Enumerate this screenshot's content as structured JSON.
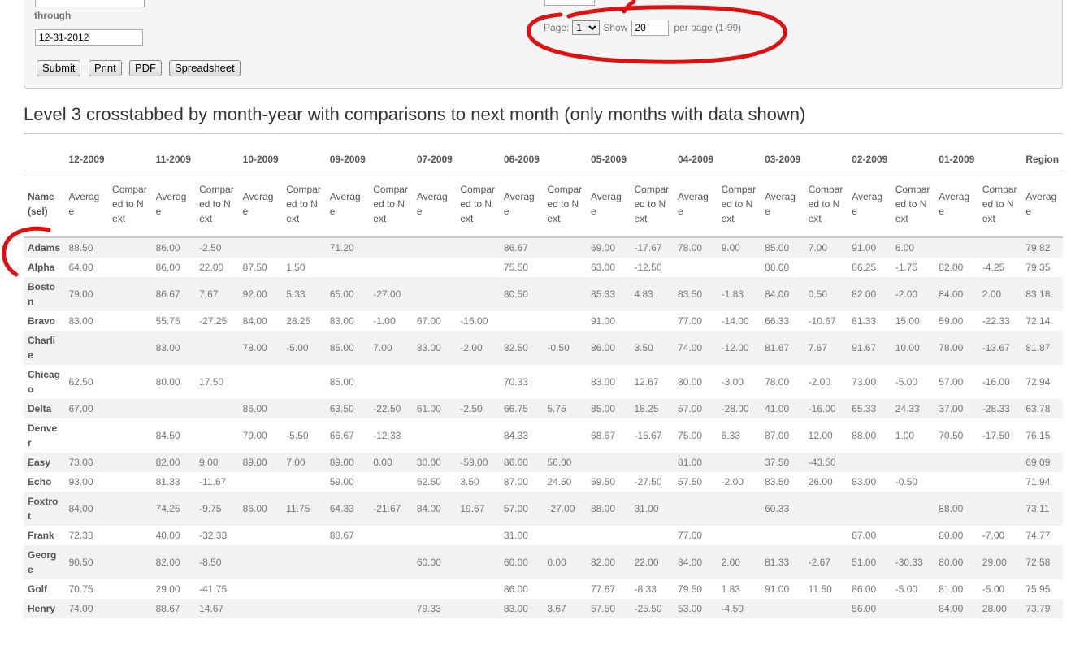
{
  "form": {
    "through_label": "through",
    "end_date": "12-31-2012",
    "buttons": [
      "Submit",
      "Print",
      "PDF",
      "Spreadsheet"
    ],
    "page_label": "Page:",
    "page_value": "1",
    "show_label": "Show",
    "show_value": "20",
    "per_page_label": "per page (1-99)"
  },
  "report_title": "Level 3 crosstabbed by month-year with comparisons to next month (only months with data shown)",
  "table": {
    "months": [
      "12-2009",
      "11-2009",
      "10-2009",
      "09-2009",
      "07-2009",
      "06-2009",
      "05-2009",
      "04-2009",
      "03-2009",
      "02-2009",
      "01-2009"
    ],
    "region_label": "Region",
    "name_header": "Name (sel)",
    "average_header": "Average",
    "compared_header": "Compared to Next",
    "rows": [
      {
        "name": "Adams",
        "cells": [
          "88.50",
          "",
          "86.00",
          "-2.50",
          "",
          "",
          "71.20",
          "",
          "",
          "",
          "86.67",
          "",
          "69.00",
          "-17.67",
          "78.00",
          "9.00",
          "85.00",
          "7.00",
          "91.00",
          "6.00",
          "",
          ""
        ],
        "region": "79.82"
      },
      {
        "name": "Alpha",
        "cells": [
          "64.00",
          "",
          "86.00",
          "22.00",
          "87.50",
          "1.50",
          "",
          "",
          "",
          "",
          "75.50",
          "",
          "63.00",
          "-12.50",
          "",
          "",
          "88.00",
          "",
          "86.25",
          "-1.75",
          "82.00",
          "-4.25"
        ],
        "region": "79.35"
      },
      {
        "name": "Boston",
        "cells": [
          "79.00",
          "",
          "86.67",
          "7.67",
          "92.00",
          "5.33",
          "65.00",
          "-27.00",
          "",
          "",
          "80.50",
          "",
          "85.33",
          "4.83",
          "83.50",
          "-1.83",
          "84.00",
          "0.50",
          "82.00",
          "-2.00",
          "84.00",
          "2.00"
        ],
        "region": "83.18"
      },
      {
        "name": "Bravo",
        "cells": [
          "83.00",
          "",
          "55.75",
          "-27.25",
          "84.00",
          "28.25",
          "83.00",
          "-1.00",
          "67.00",
          "-16.00",
          "",
          "",
          "91.00",
          "",
          "77.00",
          "-14.00",
          "66.33",
          "-10.67",
          "81.33",
          "15.00",
          "59.00",
          "-22.33"
        ],
        "region": "72.14"
      },
      {
        "name": "Charlie",
        "cells": [
          "",
          "",
          "83.00",
          "",
          "78.00",
          "-5.00",
          "85.00",
          "7.00",
          "83.00",
          "-2.00",
          "82.50",
          "-0.50",
          "86.00",
          "3.50",
          "74.00",
          "-12.00",
          "81.67",
          "7.67",
          "91.67",
          "10.00",
          "78.00",
          "-13.67"
        ],
        "region": "81.87"
      },
      {
        "name": "Chicago",
        "cells": [
          "62.50",
          "",
          "80.00",
          "17.50",
          "",
          "",
          "85.00",
          "",
          "",
          "",
          "70.33",
          "",
          "83.00",
          "12.67",
          "80.00",
          "-3.00",
          "78.00",
          "-2.00",
          "73.00",
          "-5.00",
          "57.00",
          "-16.00"
        ],
        "region": "72.94"
      },
      {
        "name": "Delta",
        "cells": [
          "67.00",
          "",
          "",
          "",
          "86.00",
          "",
          "63.50",
          "-22.50",
          "61.00",
          "-2.50",
          "66.75",
          "5.75",
          "85.00",
          "18.25",
          "57.00",
          "-28.00",
          "41.00",
          "-16.00",
          "65.33",
          "24.33",
          "37.00",
          "-28.33"
        ],
        "region": "63.78"
      },
      {
        "name": "Denver",
        "cells": [
          "",
          "",
          "84.50",
          "",
          "79.00",
          "-5.50",
          "66.67",
          "-12.33",
          "",
          "",
          "84.33",
          "",
          "68.67",
          "-15.67",
          "75.00",
          "6.33",
          "87.00",
          "12.00",
          "88.00",
          "1.00",
          "70.50",
          "-17.50"
        ],
        "region": "76.15"
      },
      {
        "name": "Easy",
        "cells": [
          "73.00",
          "",
          "82.00",
          "9.00",
          "89.00",
          "7.00",
          "89.00",
          "0.00",
          "30.00",
          "-59.00",
          "86.00",
          "56.00",
          "",
          "",
          "81.00",
          "",
          "37.50",
          "-43.50",
          "",
          "",
          "",
          ""
        ],
        "region": "69.09"
      },
      {
        "name": "Echo",
        "cells": [
          "93.00",
          "",
          "81.33",
          "-11.67",
          "",
          "",
          "59.00",
          "",
          "62.50",
          "3.50",
          "87.00",
          "24.50",
          "59.50",
          "-27.50",
          "57.50",
          "-2.00",
          "83.50",
          "26.00",
          "83.00",
          "-0.50",
          "",
          ""
        ],
        "region": "71.94"
      },
      {
        "name": "Foxtrot",
        "cells": [
          "84.00",
          "",
          "74.25",
          "-9.75",
          "86.00",
          "11.75",
          "64.33",
          "-21.67",
          "84.00",
          "19.67",
          "57.00",
          "-27.00",
          "88.00",
          "31.00",
          "",
          "",
          "60.33",
          "",
          "",
          "",
          "88.00",
          ""
        ],
        "region": "73.11"
      },
      {
        "name": "Frank",
        "cells": [
          "72.33",
          "",
          "40.00",
          "-32.33",
          "",
          "",
          "88.67",
          "",
          "",
          "",
          "31.00",
          "",
          "",
          "",
          "77.00",
          "",
          "",
          "",
          "87.00",
          "",
          "80.00",
          "-7.00"
        ],
        "region": "74.77"
      },
      {
        "name": "George",
        "cells": [
          "90.50",
          "",
          "82.00",
          "-8.50",
          "",
          "",
          "",
          "",
          "60.00",
          "",
          "60.00",
          "0.00",
          "82.00",
          "22.00",
          "84.00",
          "2.00",
          "81.33",
          "-2.67",
          "51.00",
          "-30.33",
          "80.00",
          "29.00"
        ],
        "region": "72.58"
      },
      {
        "name": "Golf",
        "cells": [
          "70.75",
          "",
          "29.00",
          "-41.75",
          "",
          "",
          "",
          "",
          "",
          "",
          "86.00",
          "",
          "77.67",
          "-8.33",
          "79.50",
          "1.83",
          "91.00",
          "11.50",
          "86.00",
          "-5.00",
          "81.00",
          "-5.00"
        ],
        "region": "75.95"
      },
      {
        "name": "Henry",
        "cells": [
          "74.00",
          "",
          "88.67",
          "14.67",
          "",
          "",
          "",
          "",
          "79.33",
          "",
          "83.00",
          "3.67",
          "57.50",
          "-25.50",
          "53.00",
          "-4.50",
          "",
          "",
          "56.00",
          "",
          "84.00",
          "28.00"
        ],
        "region": "73.79"
      }
    ]
  },
  "annotation_color": "#e01010"
}
